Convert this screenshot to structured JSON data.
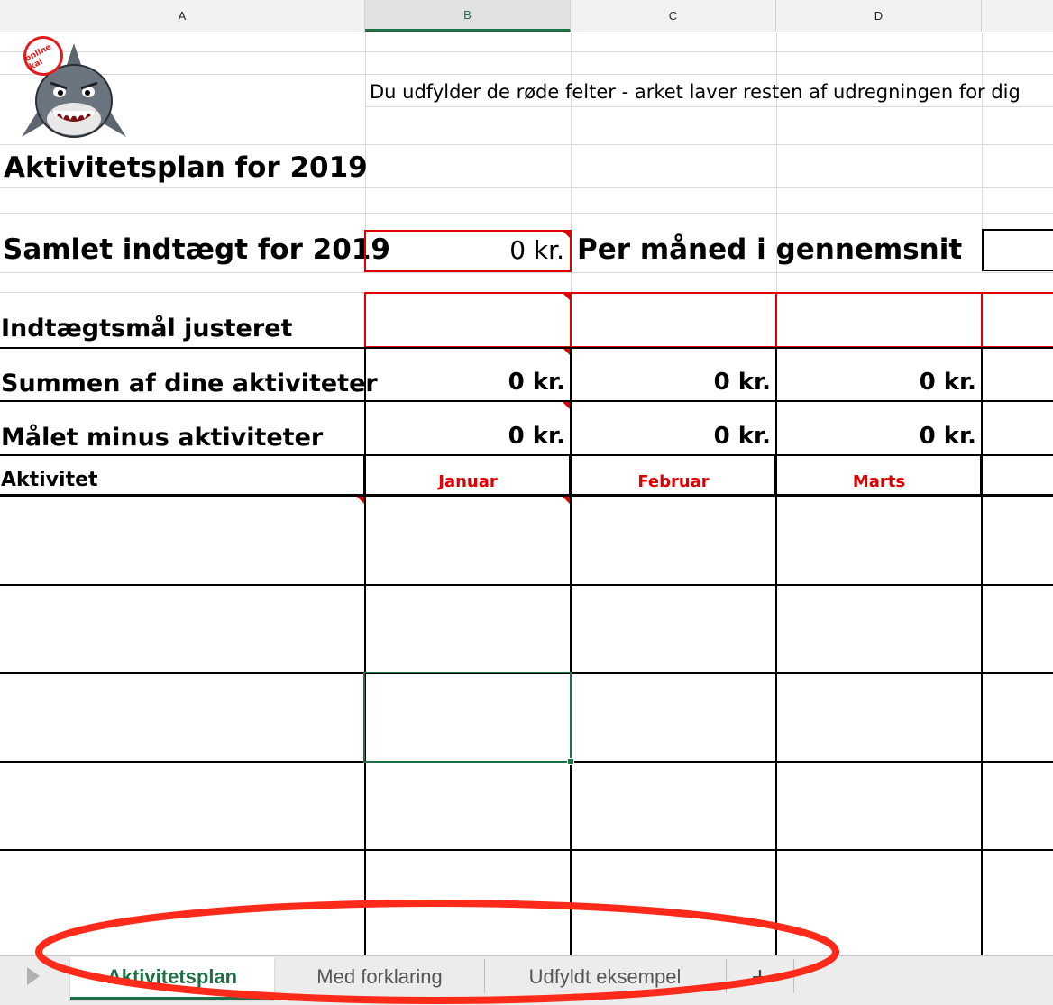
{
  "columns": [
    "A",
    "B",
    "C",
    "D"
  ],
  "logo": {
    "badge_text": "online kai",
    "icon": "shark-mascot-icon"
  },
  "instruction_text": "Du udfylder de røde felter - arket laver resten af udregningen for dig",
  "title": "Aktivitetsplan for 2019",
  "income": {
    "label": "Samlet indtægt for 2019",
    "value": "0 kr.",
    "avg_label": "Per måned i gennemsnit"
  },
  "rows": {
    "adjusted_goal_label": "Indtægtsmål justeret",
    "sum_label": "Summen af dine aktiviteter",
    "sum_values": [
      "0 kr.",
      "0 kr.",
      "0 kr."
    ],
    "diff_label": "Målet minus aktiviteter",
    "diff_values": [
      "0 kr.",
      "0 kr.",
      "0 kr."
    ]
  },
  "activity_header": "Aktivitet",
  "months": [
    "Januar",
    "Februar",
    "Marts"
  ],
  "sheet_tabs": [
    "Aktivitetsplan",
    "Med forklaring",
    "Udfyldt eksempel"
  ],
  "add_sheet_label": "+",
  "colors": {
    "accent_green": "#1e7145",
    "required_red": "#e00000",
    "annotation_red": "#ff2a1a"
  }
}
